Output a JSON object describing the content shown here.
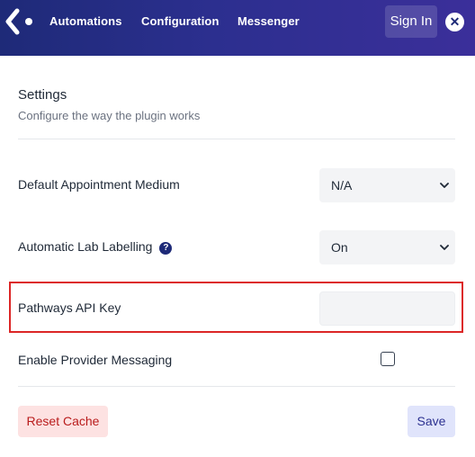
{
  "header": {
    "logo_icon": "logo-icon",
    "nav": [
      "Automations",
      "Configuration",
      "Messenger"
    ],
    "signin_label": "Sign In",
    "close_icon": "close-icon",
    "colors": {
      "bar_start": "#1e2a78",
      "bar_end": "#3b2f9a"
    }
  },
  "settings": {
    "title": "Settings",
    "subtitle": "Configure the way the plugin works",
    "rows": {
      "appointment": {
        "label": "Default Appointment Medium",
        "value": "N/A"
      },
      "lab": {
        "label": "Automatic Lab Labelling",
        "value": "On",
        "help_icon": "question-mark-icon"
      },
      "pathways": {
        "label": "Pathways API Key",
        "value": "",
        "highlight_color": "#dc2626"
      },
      "messaging": {
        "label": "Enable Provider Messaging",
        "checked": false
      }
    }
  },
  "actions": {
    "reset_label": "Reset Cache",
    "save_label": "Save",
    "reset_color": "#b91c1c",
    "save_color": "#2c3190"
  }
}
